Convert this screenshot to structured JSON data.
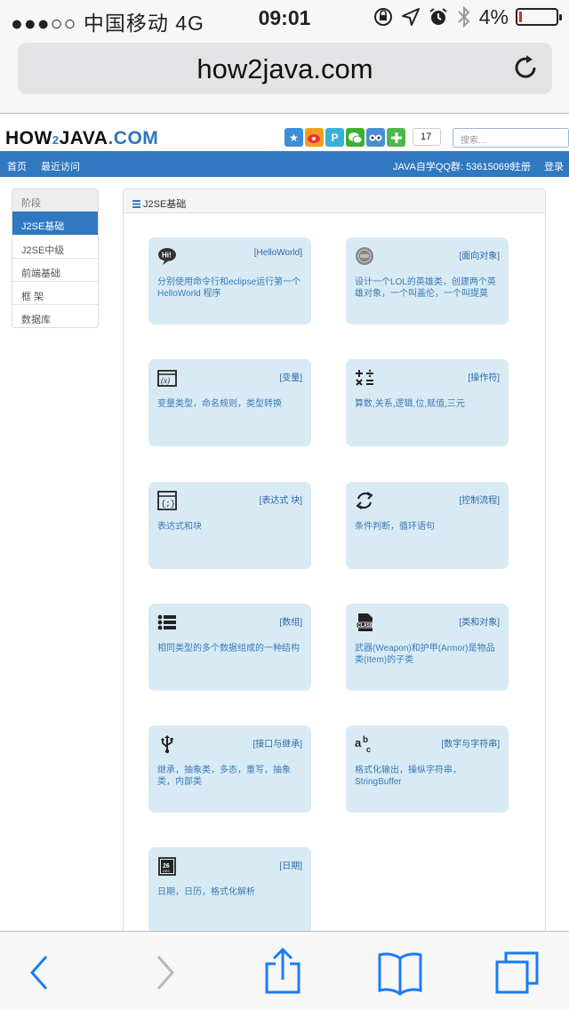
{
  "status_bar": {
    "carrier": "●●●○○ 中国移动  4G",
    "time": "09:01",
    "battery": "4%",
    "battery_level": 0.04
  },
  "browser": {
    "url": "how2java.com",
    "reload_icon": "reload-icon"
  },
  "site": {
    "logo_how": "HOW",
    "logo_2": "2",
    "logo_java": "JAVA",
    "logo_com": ".COM",
    "share_count": "17",
    "search_placeholder": "搜索...",
    "share_icons": [
      "star-icon",
      "weibo-icon",
      "pinterest-icon",
      "wechat-icon",
      "qzone-icon",
      "plus-icon"
    ],
    "nav": {
      "home": "首页",
      "recent": "最近访问",
      "qq_group": "JAVA自学QQ群: 536150699",
      "register": "注册",
      "login": "登录"
    }
  },
  "sidebar": {
    "header": "阶段",
    "items": [
      {
        "label": "J2SE基础",
        "active": true
      },
      {
        "label": "J2SE中级",
        "active": false
      },
      {
        "label": "前端基础",
        "active": false
      },
      {
        "label": "框 架",
        "active": false
      },
      {
        "label": "数据库",
        "active": false
      }
    ]
  },
  "panel": {
    "title": "J2SE基础",
    "cards": [
      {
        "tag": "[HelloWorld]",
        "desc": "分别使用命令行和eclipse运行第一个HelloWorld 程序",
        "icon": "hi-speech-icon"
      },
      {
        "tag": "[面向对象]",
        "desc": "设计一个LOL的英雄类，创建两个英雄对象，一个叫盖伦，一个叫提莫",
        "icon": "object-icon"
      },
      {
        "tag": "[变量]",
        "desc": "变量类型，命名规则，类型转换",
        "icon": "variable-icon"
      },
      {
        "tag": "[操作符]",
        "desc": "算数,关系,逻辑,位,赋值,三元",
        "icon": "operators-icon"
      },
      {
        "tag": "[表达式 块]",
        "desc": "表达式和块",
        "icon": "code-block-icon"
      },
      {
        "tag": "[控制流程]",
        "desc": "条件判断，循环语句",
        "icon": "loop-icon"
      },
      {
        "tag": "[数组]",
        "desc": "相同类型的多个数据组成的一种结构",
        "icon": "list-icon"
      },
      {
        "tag": "[类和对象]",
        "desc": "武器(Weapon)和护甲(Armor)是物品类(Item)的子类",
        "icon": "class-file-icon"
      },
      {
        "tag": "[接口与继承]",
        "desc": "继承，抽象类，多态，重写，抽象类，内部类",
        "icon": "usb-icon"
      },
      {
        "tag": "[数字与字符串]",
        "desc": "格式化输出，操纵字符串，StringBuffer",
        "icon": "spellcheck-icon"
      },
      {
        "tag": "[日期]",
        "desc": "日期，日历，格式化解析",
        "icon": "calendar-icon"
      }
    ],
    "calendar_icon_text": {
      "day": "26",
      "month": "DEC"
    }
  },
  "toolbar": {
    "buttons": [
      "back-icon",
      "forward-icon",
      "share-icon",
      "bookmarks-icon",
      "tabs-icon"
    ]
  }
}
